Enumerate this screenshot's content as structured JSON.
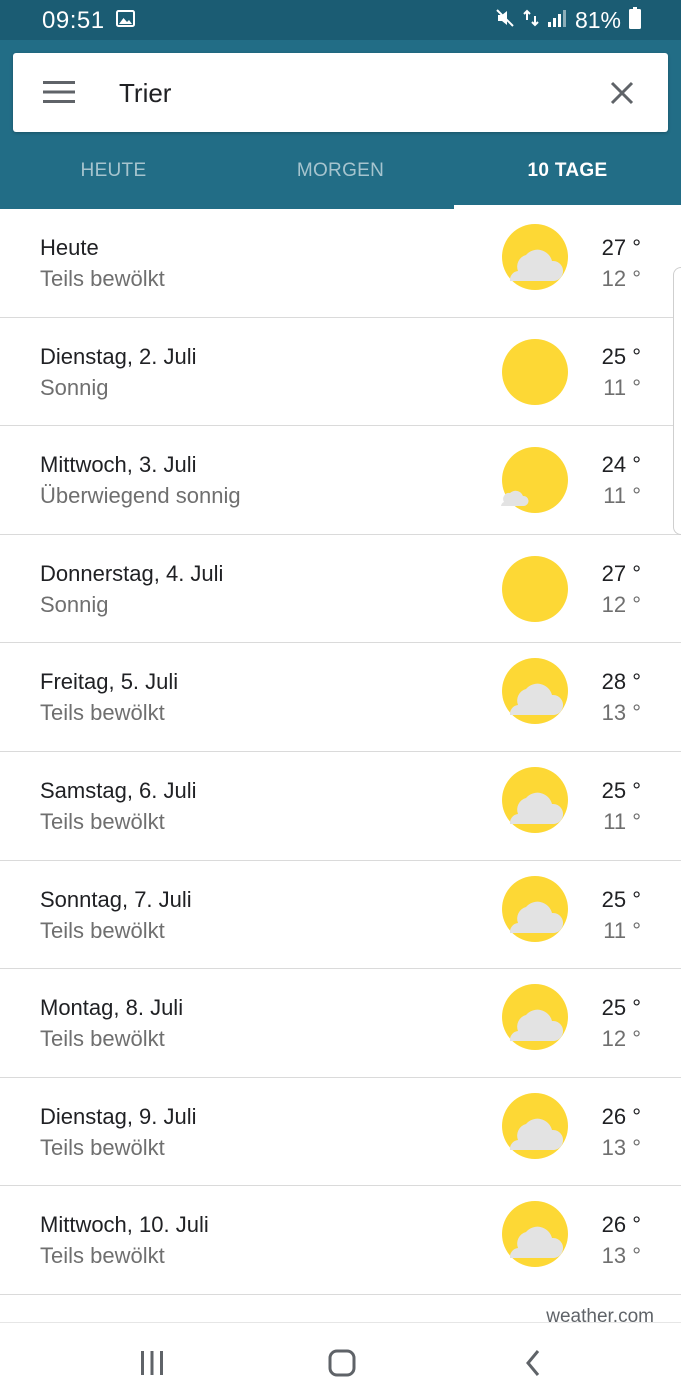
{
  "status_bar": {
    "time": "09:51",
    "battery_text": "81%",
    "icons": [
      "image-icon",
      "mute-icon",
      "data-arrows-icon",
      "signal-icon",
      "battery-icon"
    ]
  },
  "search": {
    "value": "Trier"
  },
  "tabs": [
    {
      "label": "HEUTE",
      "active": false
    },
    {
      "label": "MORGEN",
      "active": false
    },
    {
      "label": "10 TAGE",
      "active": true
    }
  ],
  "days": [
    {
      "name": "Heute",
      "condition": "Teils bewölkt",
      "high": "27 °",
      "low": "12 °",
      "icon": "partly-cloudy-icon"
    },
    {
      "name": "Dienstag, 2. Juli",
      "condition": "Sonnig",
      "high": "25 °",
      "low": "11 °",
      "icon": "sunny-icon"
    },
    {
      "name": "Mittwoch, 3. Juli",
      "condition": "Überwiegend sonnig",
      "high": "24 °",
      "low": "11 °",
      "icon": "mostly-sunny-icon"
    },
    {
      "name": "Donnerstag, 4. Juli",
      "condition": "Sonnig",
      "high": "27 °",
      "low": "12 °",
      "icon": "sunny-icon"
    },
    {
      "name": "Freitag, 5. Juli",
      "condition": "Teils bewölkt",
      "high": "28 °",
      "low": "13 °",
      "icon": "partly-cloudy-icon"
    },
    {
      "name": "Samstag, 6. Juli",
      "condition": "Teils bewölkt",
      "high": "25 °",
      "low": "11 °",
      "icon": "partly-cloudy-icon"
    },
    {
      "name": "Sonntag, 7. Juli",
      "condition": "Teils bewölkt",
      "high": "25 °",
      "low": "11 °",
      "icon": "partly-cloudy-icon"
    },
    {
      "name": "Montag, 8. Juli",
      "condition": "Teils bewölkt",
      "high": "25 °",
      "low": "12 °",
      "icon": "partly-cloudy-icon"
    },
    {
      "name": "Dienstag, 9. Juli",
      "condition": "Teils bewölkt",
      "high": "26 °",
      "low": "13 °",
      "icon": "partly-cloudy-icon"
    },
    {
      "name": "Mittwoch, 10. Juli",
      "condition": "Teils bewölkt",
      "high": "26 °",
      "low": "13 °",
      "icon": "partly-cloudy-icon"
    }
  ],
  "attribution": "weather.com",
  "colors": {
    "status_bar": "#1b5c73",
    "header": "#226d86",
    "sun": "#fdd835",
    "sun_edge": "#f9c02c",
    "cloud": "#e3e3e3"
  }
}
